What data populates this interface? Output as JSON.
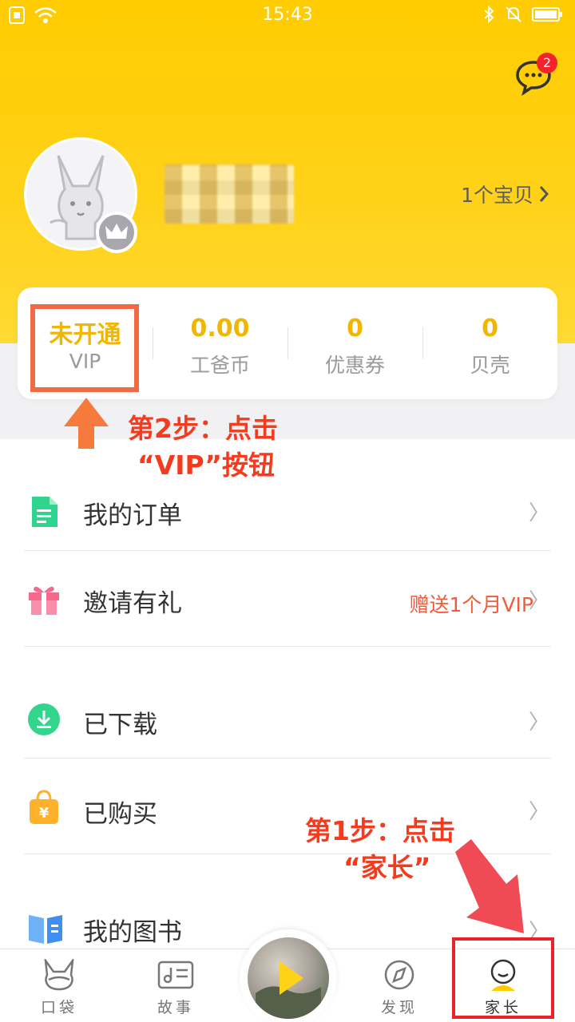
{
  "status_bar": {
    "time": "15:43"
  },
  "header": {
    "message_badge": "2",
    "children_link": "1个宝贝"
  },
  "stats": [
    {
      "value": "未开通",
      "label": "VIP"
    },
    {
      "value": "0.00",
      "label": "工爸币"
    },
    {
      "value": "0",
      "label": "优惠券"
    },
    {
      "value": "0",
      "label": "贝壳"
    }
  ],
  "annotations": {
    "step2_line1": "第2步：点击",
    "step2_line2": "“VIP”按钮",
    "step1_line1": "第1步：点击",
    "step1_line2": "“家长”"
  },
  "menu": [
    {
      "label": "我的订单",
      "extra": "",
      "icon": "order-icon",
      "color": "#2fd58e"
    },
    {
      "label": "邀请有礼",
      "extra": "赠送1个月VIP",
      "icon": "gift-icon",
      "color": "#f46a8c"
    },
    {
      "label": "已下载",
      "extra": "",
      "icon": "download-icon",
      "color": "#33d48b"
    },
    {
      "label": "已购买",
      "extra": "",
      "icon": "purchase-bag-icon",
      "color": "#ffb12c"
    },
    {
      "label": "我的图书",
      "extra": "",
      "icon": "book-icon",
      "color": "#3f8ff2"
    }
  ],
  "tabs": [
    {
      "label": "口袋",
      "icon": "pocket-icon"
    },
    {
      "label": "故事",
      "icon": "story-icon"
    },
    {
      "label": "发现",
      "icon": "discover-compass-icon"
    },
    {
      "label": "家长",
      "icon": "parent-icon",
      "active": true
    }
  ],
  "colors": {
    "brand_yellow": "#ffcc00",
    "value_gold": "#f2b600",
    "annotation_red": "#f53a1e",
    "highlight_red": "#e8232a"
  }
}
